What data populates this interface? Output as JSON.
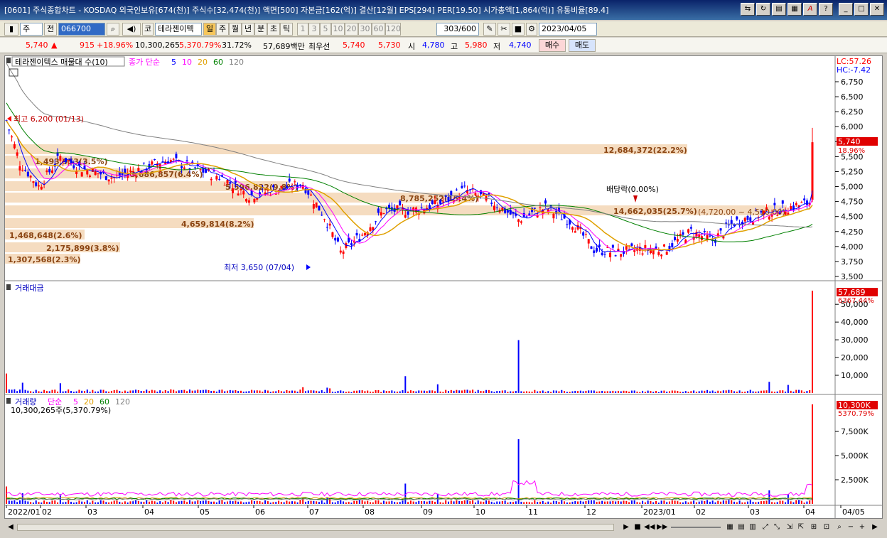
{
  "window": {
    "title": "[0601] 주식종합차트 - KOSDAQ 외국인보유[674(천)] 주식수[32,474(천)] 액면[500] 자본금[162(억)] 결산[12월] EPS[294] PER[19.50] 시가총액[1,864(억)] 유통비율[89.4]"
  },
  "toolbar": {
    "market": "주",
    "prev_label": "전",
    "code": "066700",
    "exchange_label": "코",
    "stock_name": "테라젠이텍",
    "periods": [
      "일",
      "주",
      "월",
      "년",
      "분",
      "초",
      "틱"
    ],
    "selected_period": "일",
    "intervals": [
      "1",
      "3",
      "5",
      "10",
      "20",
      "30",
      "60",
      "120"
    ],
    "count": "303",
    "count_max": "/600",
    "date": "2023/04/05"
  },
  "quote": {
    "price": "5,740",
    "arrow": "▲",
    "change": "915",
    "change_pct": "+18.96%",
    "volume": "10,300,265",
    "volume_pct": "5,370.79%",
    "turnover": "31.72%",
    "amount": "57,689백만",
    "best_label": "최우선",
    "ask": "5,740",
    "bid": "5,730",
    "open_label": "시",
    "open": "4,780",
    "high_label": "고",
    "high": "5,980",
    "low_label": "저",
    "low": "4,740",
    "buy_label": "매수",
    "sell_label": "매도"
  },
  "price_panel": {
    "legend_name": "테라젠이텍스 매물대 수(10)",
    "ma_label": "종가 단순",
    "ma_periods": [
      "5",
      "10",
      "20",
      "60",
      "120"
    ],
    "ma_colors": [
      "#0000ff",
      "#ff00ff",
      "#e0a000",
      "#008000",
      "#808080"
    ],
    "lc": "LC:57.26",
    "hc": "HC:-7.42",
    "y_ticks": [
      "6,750",
      "6,500",
      "6,250",
      "6,000",
      "5,750",
      "5,500",
      "5,250",
      "5,000",
      "4,750",
      "4,500",
      "4,250",
      "4,000",
      "3,750",
      "3,500"
    ],
    "current_price": "5,740",
    "current_pct": "18.96%",
    "high_annotation": "최고 6,200 (01/13)",
    "low_annotation": "최저 3,650 (07/04)",
    "dividend_annotation": "배당락(0.00%)",
    "volume_profile": [
      {
        "label": "12,684,372(22.2%)"
      },
      {
        "label": "1,493,953(3.5%)"
      },
      {
        "label": "3,686,857(6.4%)"
      },
      {
        "label": "5,596,822(9.8%)"
      },
      {
        "label": "8,785,252(15.4%)"
      },
      {
        "label": "14,662,035(25.7%)"
      },
      {
        "label": "4,659,814(8.2%)"
      },
      {
        "label": "1,468,648(2.6%)"
      },
      {
        "label": "2,175,899(3.8%)"
      },
      {
        "label": "1,307,568(2.3%)"
      }
    ],
    "range_annotation": "(4,720.00 ~ 4,510.00)"
  },
  "amount_panel": {
    "title": "거래대금",
    "y_ticks": [
      "50,000",
      "40,000",
      "30,000",
      "20,000",
      "10,000"
    ],
    "current": "57,689",
    "current_pct": "6367.44%"
  },
  "volume_panel": {
    "title": "거래량",
    "ma_label": "단순",
    "ma_periods": [
      "5",
      "20",
      "60",
      "120"
    ],
    "sub_label": "10,300,265주(5,370.79%)",
    "y_ticks": [
      "7,500K",
      "5,000K",
      "2,500K"
    ],
    "current": "10,300K",
    "current_pct": "5370.79%"
  },
  "x_axis": {
    "labels": [
      "2022/01",
      "02",
      "03",
      "04",
      "05",
      "06",
      "07",
      "08",
      "09",
      "10",
      "11",
      "12",
      "2023/01",
      "02",
      "03",
      "04",
      "04/05"
    ]
  },
  "colors": {
    "up": "#ff0000",
    "down": "#0000ff",
    "profile": "#f5dcc0",
    "profile_text": "#8b4513"
  }
}
